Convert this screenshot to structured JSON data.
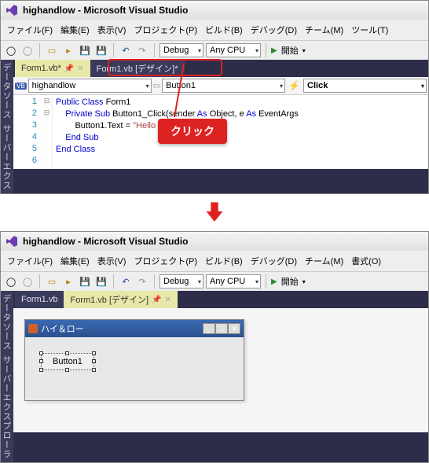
{
  "top": {
    "title": "highandlow - Microsoft Visual Studio",
    "menu": {
      "file": "ファイル(F)",
      "edit": "編集(E)",
      "view": "表示(V)",
      "project": "プロジェクト(P)",
      "build": "ビルド(B)",
      "debug": "デバッグ(D)",
      "team": "チーム(M)",
      "tool": "ツール(T)"
    },
    "config": "Debug",
    "platform": "Any CPU",
    "start": "開始",
    "sidebar": {
      "a": "データソース",
      "b": "サーバーエクス"
    },
    "tabs": {
      "inactive": "Form1.vb*",
      "active": "Form1.vb [デザイン]*"
    },
    "dropdowns": {
      "class": "highandlow",
      "member": "Button1",
      "event": "Click"
    },
    "vbBadge": "VB",
    "code": {
      "l1a": "Public",
      "l1b": "Class",
      "l1c": " Form1",
      "l2a": "Private",
      "l2b": "Sub",
      "l2c": " Button1_Click(sender ",
      "l2d": "As",
      "l2e": " Object",
      "l2f": ", e ",
      "l2g": "As",
      "l2h": " EventArgs",
      "l3a": "Button1.Text = ",
      "l3b": "\"Hello Basic\"",
      "l4a": "End",
      "l4b": "Sub",
      "l5a": "End",
      "l5b": "Class"
    },
    "lineNums": [
      "1",
      "2",
      "3",
      "4",
      "5",
      "6"
    ],
    "callout": "クリック"
  },
  "bottom": {
    "title": "highandlow - Microsoft Visual Studio",
    "menu": {
      "file": "ファイル(F)",
      "edit": "編集(E)",
      "view": "表示(V)",
      "project": "プロジェクト(P)",
      "build": "ビルド(B)",
      "debug": "デバッグ(D)",
      "team": "チーム(M)",
      "format": "書式(O)"
    },
    "config": "Debug",
    "platform": "Any CPU",
    "start": "開始",
    "sidebar": {
      "a": "データソース",
      "b": "サーバーエクスプローラ"
    },
    "tabs": {
      "inactive": "Form1.vb",
      "active": "Form1.vb [デザイン]"
    },
    "formTitle": "ハイ＆ロー",
    "buttonText": "Button1"
  }
}
